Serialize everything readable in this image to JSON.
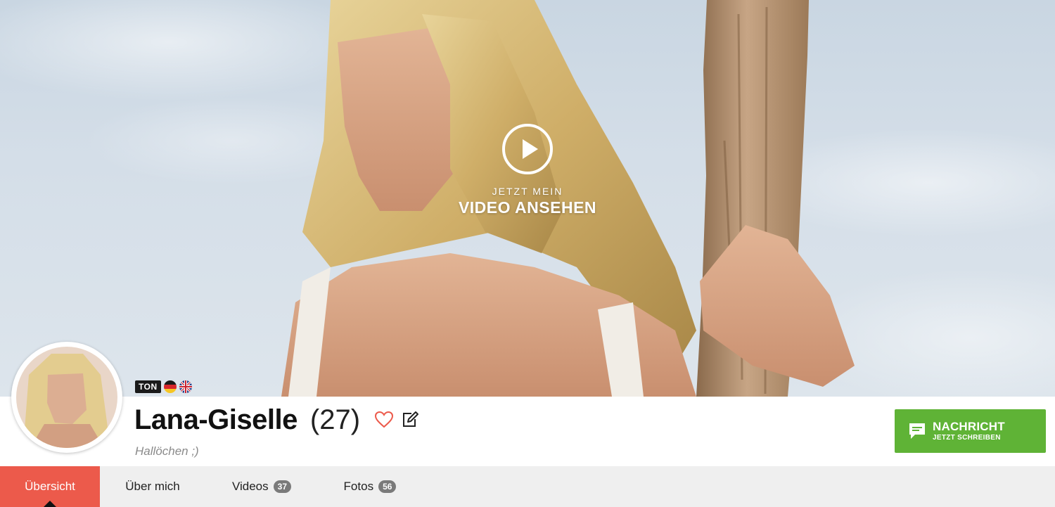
{
  "hero": {
    "cta_small": "JETZT MEIN",
    "cta_big": "VIDEO ANSEHEN"
  },
  "profile": {
    "badge": "TON",
    "languages": [
      "de-flag-icon",
      "uk-flag-icon"
    ],
    "name": "Lana-Giselle",
    "age": "(27)",
    "status": "Hallöchen ;)"
  },
  "message_button": {
    "line1": "NACHRICHT",
    "line2": "JETZT SCHREIBEN"
  },
  "tabs": [
    {
      "label": "Übersicht",
      "count": null,
      "active": true
    },
    {
      "label": "Über mich",
      "count": null,
      "active": false
    },
    {
      "label": "Videos",
      "count": "37",
      "active": false
    },
    {
      "label": "Fotos",
      "count": "56",
      "active": false
    }
  ],
  "colors": {
    "accent_red": "#ec5a4b",
    "green": "#5fb336",
    "tabbar": "#efefef"
  }
}
